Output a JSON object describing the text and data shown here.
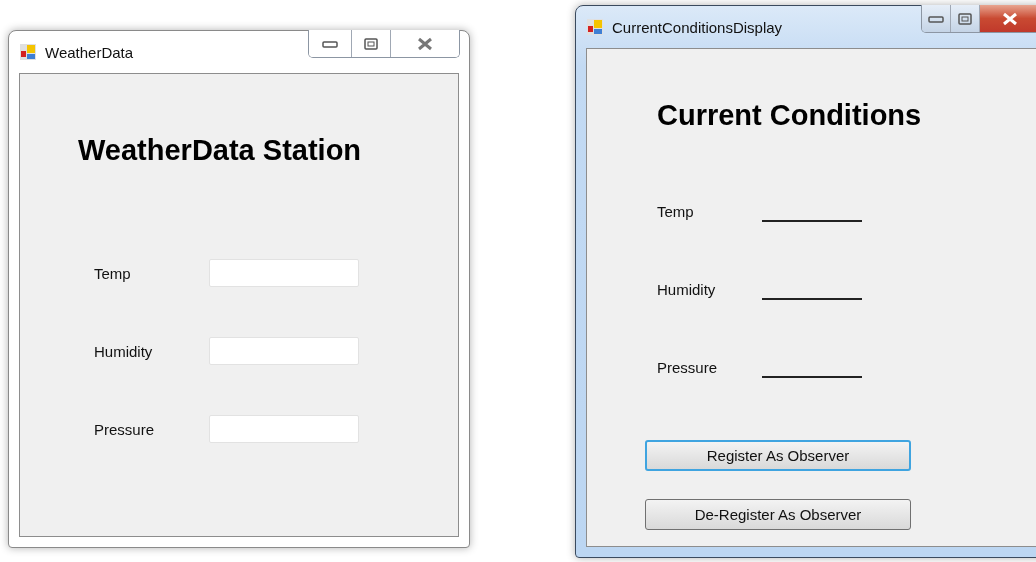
{
  "windows": [
    {
      "title": "WeatherData",
      "active": false,
      "heading": "WeatherData Station",
      "fields": [
        {
          "label": "Temp",
          "kind": "textbox"
        },
        {
          "label": "Humidity",
          "kind": "textbox"
        },
        {
          "label": "Pressure",
          "kind": "textbox"
        }
      ]
    },
    {
      "title": "CurrentConditionsDisplay",
      "active": true,
      "heading": "Current Conditions",
      "fields": [
        {
          "label": "Temp",
          "kind": "blank"
        },
        {
          "label": "Humidity",
          "kind": "blank"
        },
        {
          "label": "Pressure",
          "kind": "blank"
        }
      ],
      "buttons": [
        {
          "label": "Register As Observer",
          "focused": true
        },
        {
          "label": "De-Register As Observer",
          "focused": false
        }
      ]
    }
  ]
}
